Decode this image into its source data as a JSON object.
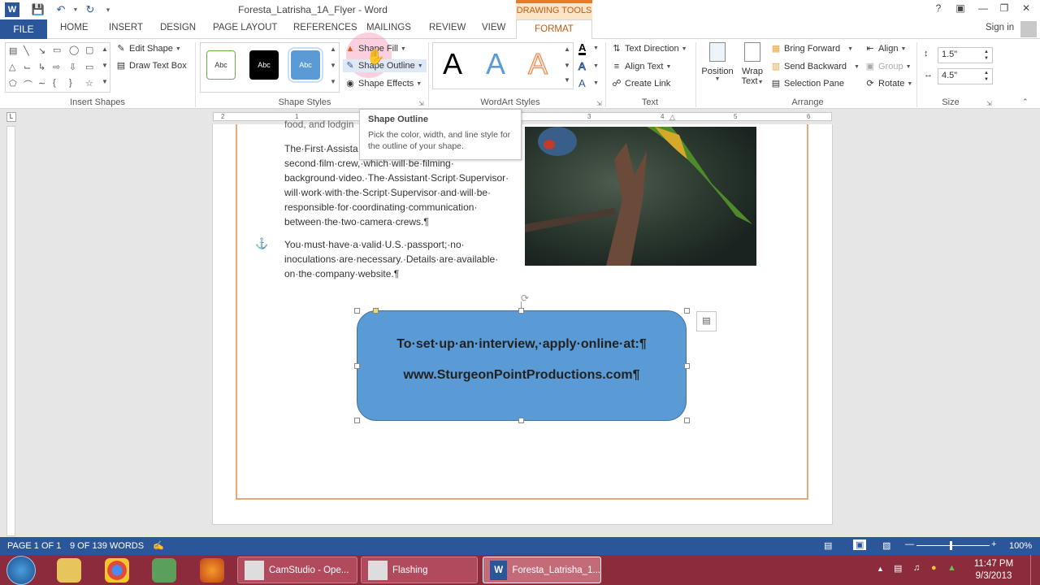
{
  "window": {
    "title": "Foresta_Latrisha_1A_Flyer - Word",
    "drawing_tools": "DRAWING TOOLS"
  },
  "tabs": [
    "FILE",
    "HOME",
    "INSERT",
    "DESIGN",
    "PAGE LAYOUT",
    "REFERENCES",
    "MAILINGS",
    "REVIEW",
    "VIEW",
    "FORMAT"
  ],
  "account": {
    "signin": "Sign in"
  },
  "ribbon": {
    "insert_shapes": {
      "label": "Insert Shapes",
      "edit_shape": "Edit Shape",
      "draw_text_box": "Draw Text Box"
    },
    "shape_styles": {
      "label": "Shape Styles",
      "swatch": "Abc",
      "fill": "Shape Fill",
      "outline": "Shape Outline",
      "effects": "Shape Effects"
    },
    "wordart": {
      "label": "WordArt Styles",
      "letter": "A"
    },
    "text": {
      "label": "Text",
      "direction": "Text Direction",
      "align": "Align Text",
      "link": "Create Link"
    },
    "arrange": {
      "label": "Arrange",
      "position": "Position",
      "wrap": "Wrap",
      "wrap2": "Text",
      "bring_forward": "Bring Forward",
      "send_backward": "Send Backward",
      "selection_pane": "Selection Pane",
      "align": "Align",
      "group": "Group",
      "rotate": "Rotate"
    },
    "size": {
      "label": "Size",
      "height": "1.5\"",
      "width": "4.5\""
    }
  },
  "tooltip": {
    "title": "Shape Outline",
    "desc": "Pick the color, width, and line style for the outline of your shape."
  },
  "doc": {
    "top_fragment": "food, and lodgin",
    "p1": "The·First·Assistant·... second·film·crew,·which·will·be·filming· background·video.·The·Assistant·Script·Supervisor· will·work·with·the·Script·Supervisor·and·will·be· responsible·for·coordinating·communication· between·the·two·camera·crews.¶",
    "p1_lines": [
      "The·First·Assista",
      "second·film·crew,·which·will·be·filming·",
      "background·video.·The·Assistant·Script·Supervisor·",
      "will·work·with·the·Script·Supervisor·and·will·be·",
      "responsible·for·coordinating·communication·",
      "between·the·two·camera·crews.¶"
    ],
    "p2_lines": [
      "You·must·have·a·valid·U.S.·passport;·no·",
      "inoculations·are·necessary.·Details·are·available·",
      "on·the·company·website.¶"
    ],
    "shape_line1": "To·set·up·an·interview,·apply·online·at:¶",
    "shape_line2": "www.SturgeonPointProductions.com¶"
  },
  "ruler": [
    "2",
    "1",
    "1",
    "2",
    "3",
    "4",
    "5",
    "6"
  ],
  "status": {
    "page": "PAGE 1 OF 1",
    "words": "9 OF 139 WORDS",
    "zoom": "100%"
  },
  "taskbar": {
    "camstudio": "CamStudio - Ope...",
    "flashing": "Flashing",
    "word": "Foresta_Latrisha_1...",
    "time": "11:47 PM",
    "date": "9/3/2013"
  },
  "colors": {
    "accent": "#2b579a",
    "format_tab": "#c05b10",
    "shape_fill": "#5b9bd5",
    "taskbar": "#8c2b3c"
  }
}
